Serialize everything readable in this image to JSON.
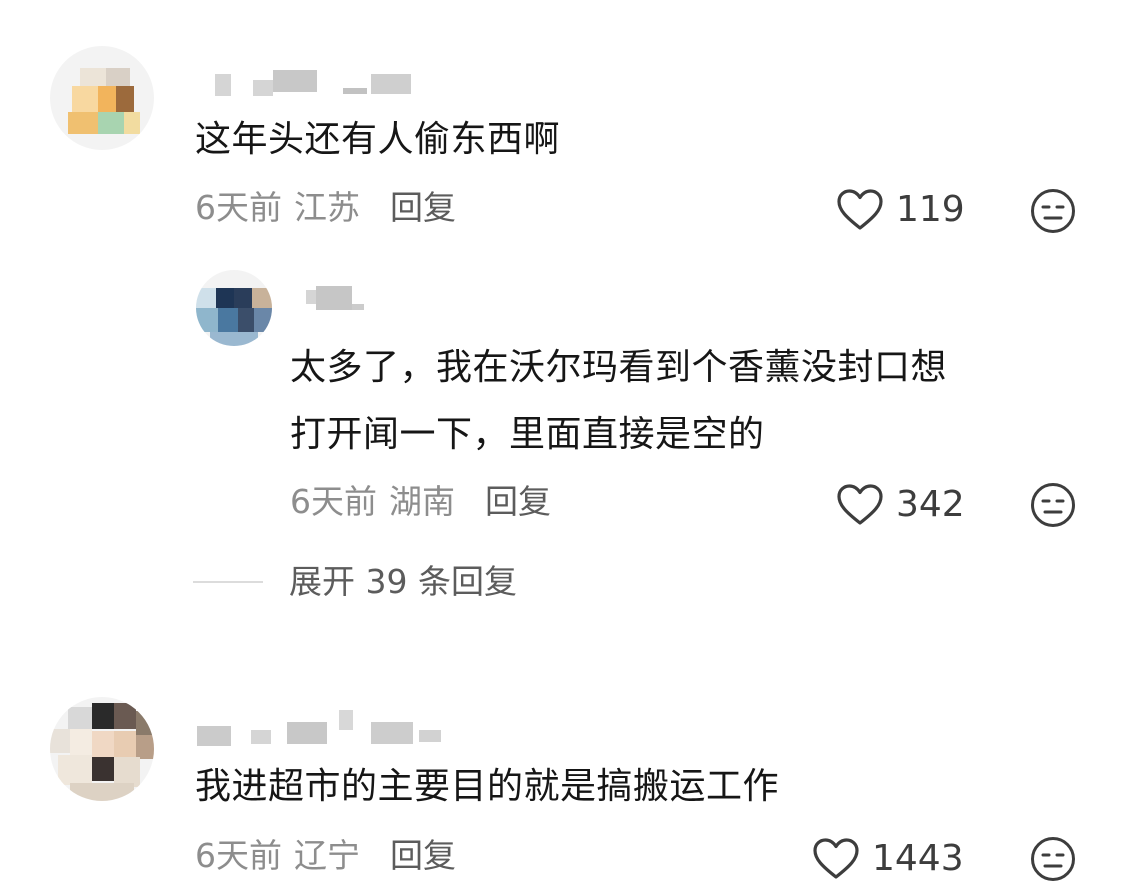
{
  "comments": [
    {
      "text": "这年头还有人偷东西啊",
      "time": "6天前",
      "location": "江苏",
      "reply_label": "回复",
      "likes": "119",
      "replies": [
        {
          "text_lines": [
            "太多了，我在沃尔玛看到个香薰没封口想",
            "打开闻一下，里面直接是空的"
          ],
          "time": "6天前",
          "location": "湖南",
          "reply_label": "回复",
          "likes": "342"
        }
      ],
      "expand_label": "展开 39 条回复"
    },
    {
      "text": "我进超市的主要目的就是搞搬运工作",
      "time": "6天前",
      "location": "辽宁",
      "reply_label": "回复",
      "likes": "1443"
    }
  ],
  "icons": {
    "like": "heart-outline-icon",
    "dislike": "neutral-face-icon"
  },
  "colors": {
    "text": "#161616",
    "meta": "#8d8d8d",
    "reply": "#5c5c5c",
    "icon": "#3d3d3d"
  }
}
